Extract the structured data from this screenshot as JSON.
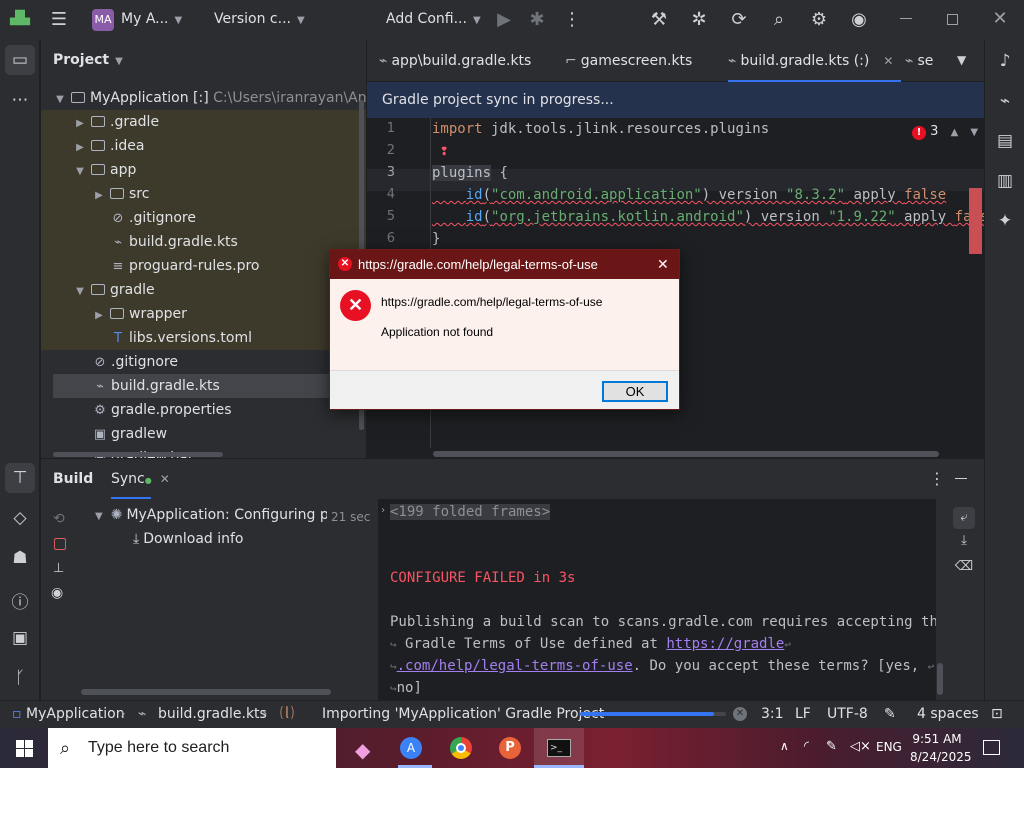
{
  "titlebar": {
    "project_badge": "MA",
    "project_name": "My A...",
    "vcs": "Version c...",
    "run_config": "Add Confi..."
  },
  "project_panel": {
    "title": "Project",
    "root_name": "MyApplication [:]",
    "root_path": "C:\\Users\\iranrayan\\Andro",
    "items": [
      {
        "label": ".gradle"
      },
      {
        "label": ".idea"
      },
      {
        "label": "app"
      },
      {
        "label": "src"
      },
      {
        "label": ".gitignore"
      },
      {
        "label": "build.gradle.kts"
      },
      {
        "label": "proguard-rules.pro"
      },
      {
        "label": "gradle"
      },
      {
        "label": "wrapper"
      },
      {
        "label": "libs.versions.toml"
      },
      {
        "label": ".gitignore"
      },
      {
        "label": "build.gradle.kts"
      },
      {
        "label": "gradle.properties"
      },
      {
        "label": "gradlew"
      },
      {
        "label": "gradlew.bat"
      }
    ]
  },
  "editor": {
    "tabs": [
      {
        "label": "app\\build.gradle.kts"
      },
      {
        "label": "gamescreen.kts"
      },
      {
        "label": "build.gradle.kts (:)"
      },
      {
        "label": "se"
      }
    ],
    "sync_banner": "Gradle project sync in progress...",
    "error_count": "3",
    "line_numbers": [
      "1",
      "2",
      "3",
      "4",
      "5",
      "6"
    ],
    "code": {
      "l1_kw": "import",
      "l1_rest": " jdk.tools.jlink.resources.plugins",
      "l3_fn": "plugins",
      "l3_rest": " {",
      "l4_id": "id",
      "l4_str": "\"com.android.application\"",
      "l4_mid": ") version ",
      "l4_ver": "\"8.3.2\"",
      "l4_apply": " apply ",
      "l4_false": "false",
      "l5_id": "id",
      "l5_str": "\"org.jetbrains.kotlin.android\"",
      "l5_mid": ") version ",
      "l5_ver": "\"1.9.22\"",
      "l5_apply": " apply ",
      "l5_false": "false",
      "l6": "}"
    }
  },
  "build_panel": {
    "tab_build": "Build",
    "tab_sync": "Sync",
    "task_name": "MyApplication:",
    "task_status": "Configuring pro",
    "task_time": "21 sec",
    "download_info": "Download info",
    "console": {
      "folded": "<199 folded frames>",
      "failed": "CONFIGURE FAILED in 3s",
      "line1": "Publishing a build scan to scans.gradle.com requires accepting the",
      "line2_pre": " Gradle Terms of Use defined at ",
      "line2_link": "https://gradle",
      "line3_link": ".com/help/legal-terms-of-use",
      "line3_post": ". Do you accept these terms? [yes, ",
      "line4": "no]"
    }
  },
  "statusbar": {
    "crumb1": "MyApplication",
    "crumb2": "build.gradle.kts",
    "task": "Importing 'MyApplication' Gradle Project",
    "progress": 0.92,
    "position": "3:1",
    "line_sep": "LF",
    "encoding": "UTF-8",
    "indent": "4 spaces"
  },
  "dialog": {
    "title": "https://gradle.com/help/legal-terms-of-use",
    "message_url": "https://gradle.com/help/legal-terms-of-use",
    "message": "Application not found",
    "ok_label": "OK"
  },
  "taskbar": {
    "search_placeholder": "Type here to search",
    "lang": "ENG",
    "time": "9:51 AM",
    "date": "8/24/2025"
  },
  "colors": {
    "accent": "#3574f0",
    "error": "#f75464",
    "dialog_title": "#6b1616"
  }
}
